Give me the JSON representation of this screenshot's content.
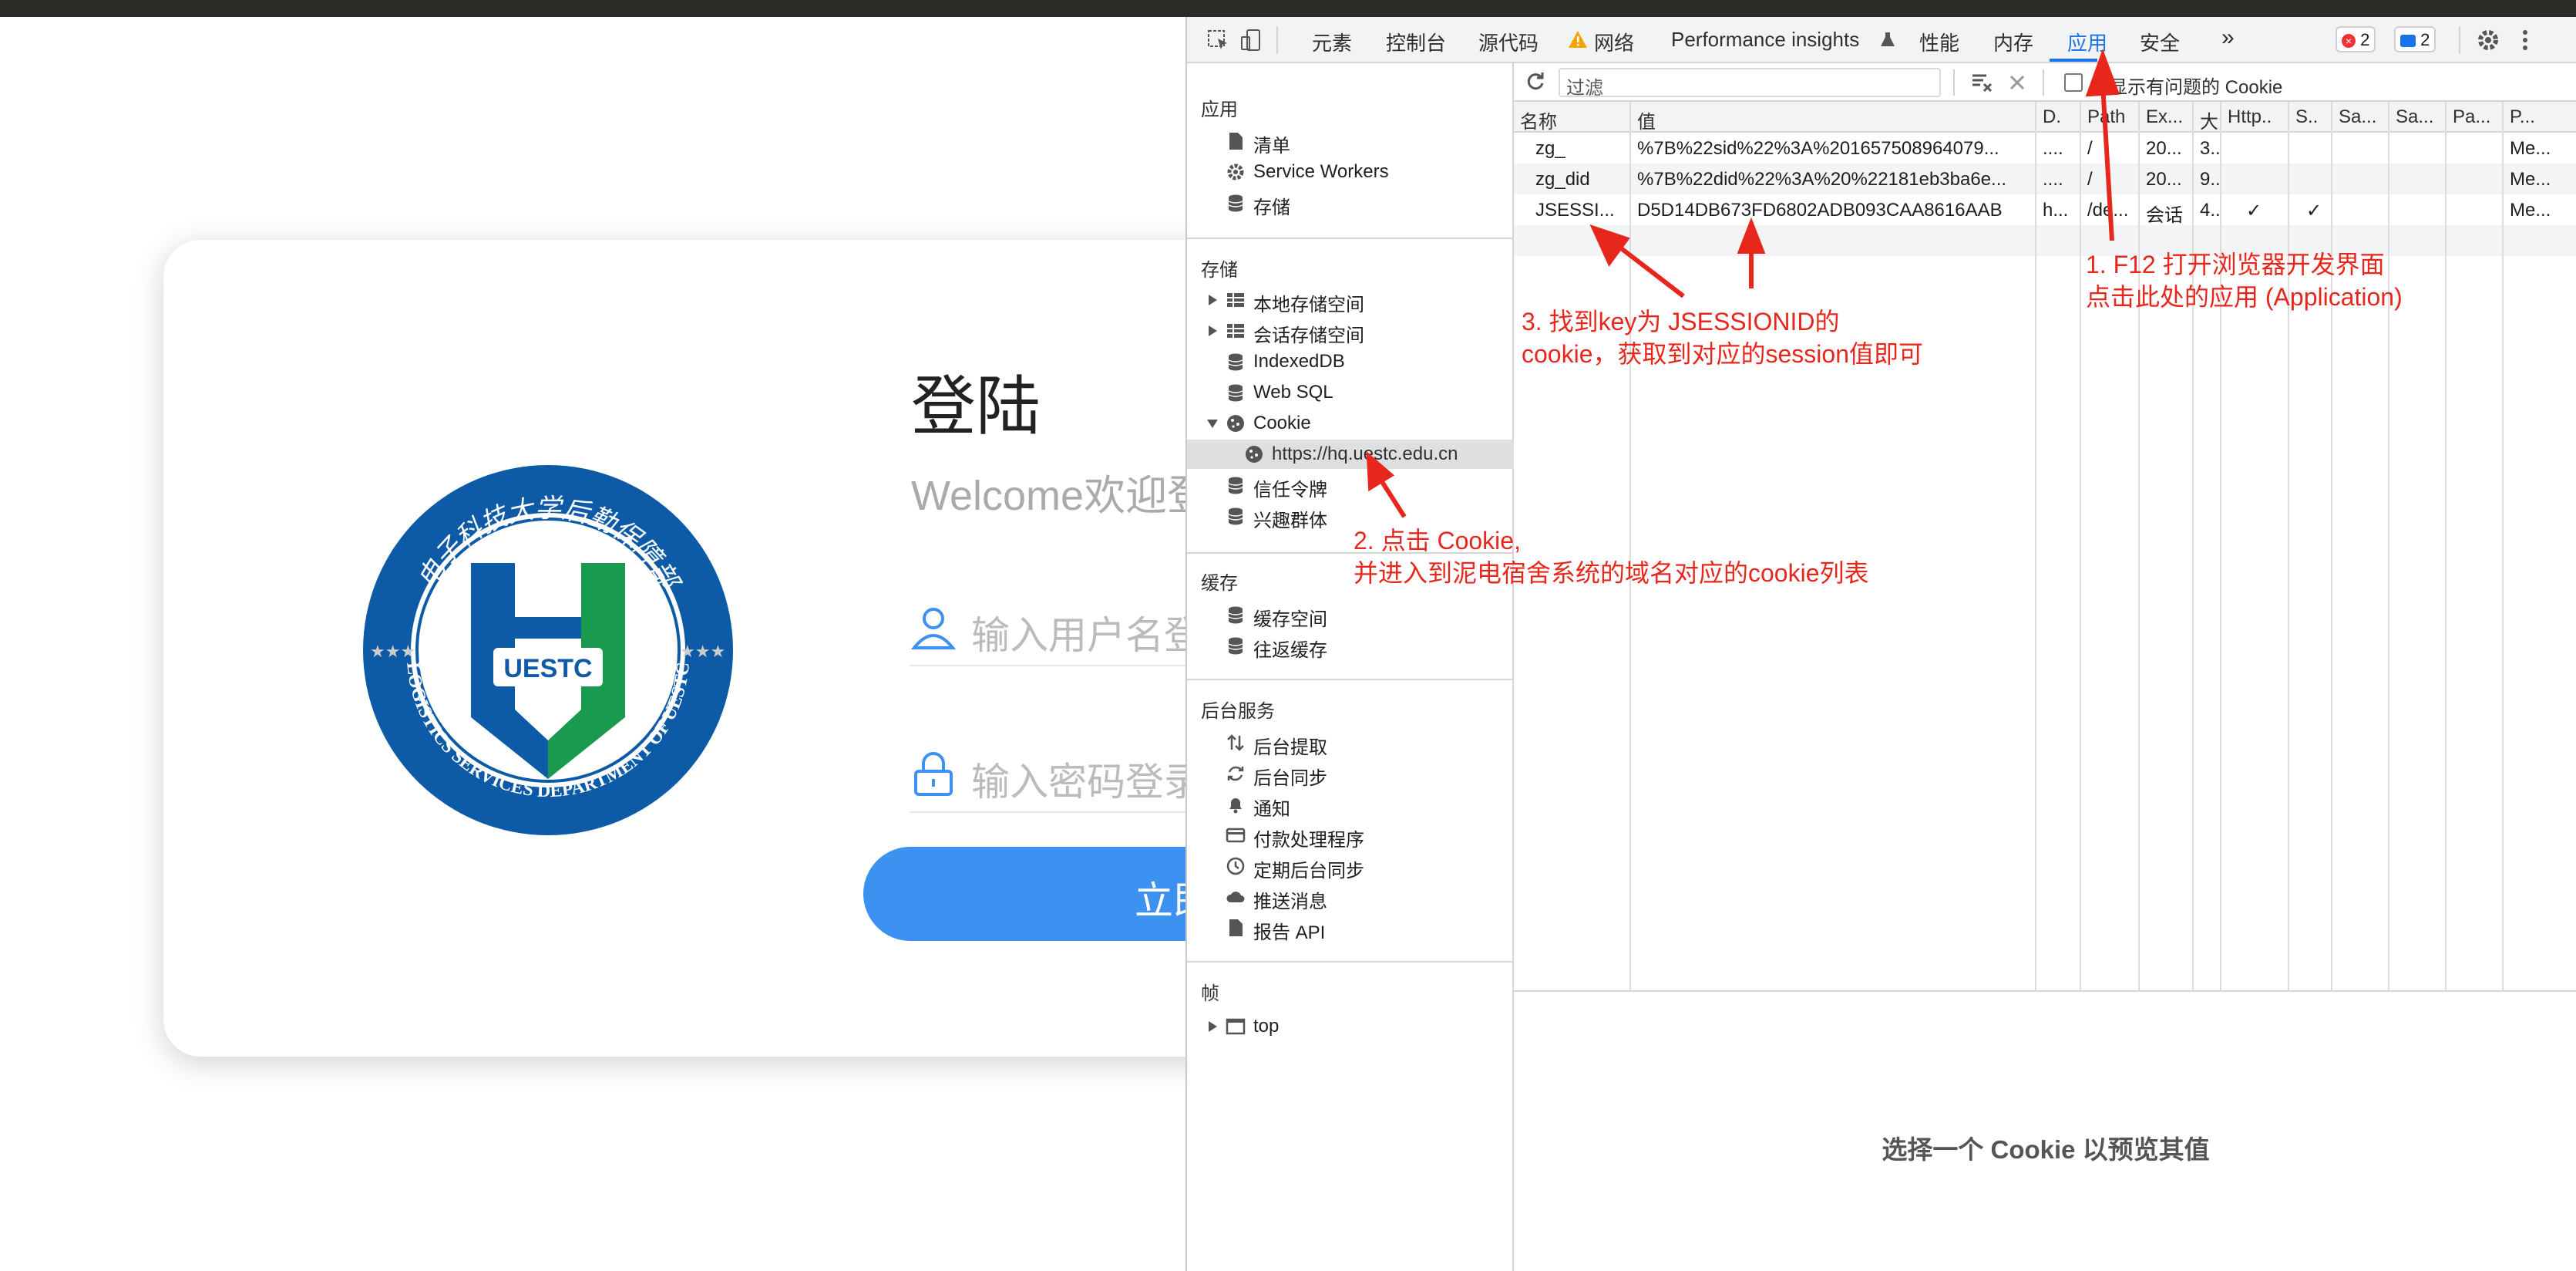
{
  "colors": {
    "accent": "#1a73e8",
    "annotation": "#e8271c",
    "login_button": "#3d91f1",
    "logo_blue": "#0d5aa7",
    "logo_green": "#1a9a4e"
  },
  "login": {
    "title": "登陆",
    "subtitle": "Welcome欢迎登",
    "username_placeholder": "输入用户名登",
    "password_placeholder": "输入密码登录",
    "button_label": "立即",
    "logo_monogram": "UESTC",
    "logo_ring_text": "LOGISTICS SERVICES DEPARTMENT OF UESTC",
    "logo_top_text": "电子科技大学后勤保障部",
    "icons": {
      "user": "user-icon",
      "lock": "lock-icon"
    }
  },
  "devtools": {
    "toolbar": {
      "tabs": [
        "元素",
        "控制台",
        "源代码",
        "网络",
        "Performance insights",
        "性能",
        "内存",
        "应用",
        "安全"
      ],
      "active_tab": "应用",
      "more": "»",
      "errors_count": "2",
      "messages_count": "2",
      "icons": [
        "inspect-icon",
        "device-toggle-icon",
        "warning-icon",
        "flask-icon",
        "settings-icon",
        "kebab-icon"
      ]
    },
    "sidebar": {
      "sections": [
        {
          "title": "应用",
          "items": [
            {
              "label": "清单",
              "icon": "file-icon"
            },
            {
              "label": "Service Workers",
              "icon": "gear-icon"
            },
            {
              "label": "存储",
              "icon": "database-icon"
            }
          ]
        },
        {
          "title": "存储",
          "items": [
            {
              "label": "本地存储空间",
              "icon": "grid-icon",
              "expand": "collapsed"
            },
            {
              "label": "会话存储空间",
              "icon": "grid-icon",
              "expand": "collapsed"
            },
            {
              "label": "IndexedDB",
              "icon": "database-icon"
            },
            {
              "label": "Web SQL",
              "icon": "database-icon"
            },
            {
              "label": "Cookie",
              "icon": "cookie-icon",
              "expand": "expanded"
            },
            {
              "label": "https://hq.uestc.edu.cn",
              "icon": "cookie-icon",
              "selected": true
            },
            {
              "label": "信任令牌",
              "icon": "database-icon"
            },
            {
              "label": "兴趣群体",
              "icon": "database-icon"
            }
          ]
        },
        {
          "title": "缓存",
          "items": [
            {
              "label": "缓存空间",
              "icon": "database-icon"
            },
            {
              "label": "往返缓存",
              "icon": "database-icon"
            }
          ]
        },
        {
          "title": "后台服务",
          "items": [
            {
              "label": "后台提取",
              "icon": "updown-arrows-icon"
            },
            {
              "label": "后台同步",
              "icon": "sync-icon"
            },
            {
              "label": "通知",
              "icon": "bell-icon"
            },
            {
              "label": "付款处理程序",
              "icon": "card-icon"
            },
            {
              "label": "定期后台同步",
              "icon": "clock-icon"
            },
            {
              "label": "推送消息",
              "icon": "cloud-icon"
            },
            {
              "label": "报告 API",
              "icon": "file-icon"
            }
          ]
        },
        {
          "title": "帧",
          "items": [
            {
              "label": "top",
              "icon": "frame-icon",
              "expand": "collapsed"
            }
          ]
        }
      ]
    },
    "filter": {
      "placeholder": "过滤",
      "show_issues_label": "仅显示有问题的 Cookie"
    },
    "cookie_table": {
      "headers": [
        "名称",
        "值",
        "D.",
        "Path",
        "Ex...",
        "大",
        "Http..",
        "S..",
        "Sa...",
        "Sa...",
        "Pa...",
        "P..."
      ],
      "rows": [
        [
          "zg_",
          "%7B%22sid%22%3A%201657508964079...",
          "....",
          "/",
          "20...",
          "3..",
          "",
          "",
          "",
          "",
          "",
          "Me..."
        ],
        [
          "zg_did",
          "%7B%22did%22%3A%20%22181eb3ba6e...",
          "....",
          "/",
          "20...",
          "9..",
          "",
          "",
          "",
          "",
          "",
          "Me..."
        ],
        [
          "JSESSI...",
          "D5D14DB673FD6802ADB093CAA8616AAB",
          "h...",
          "/de...",
          "会话",
          "4..",
          "✓",
          "✓",
          "",
          "",
          "",
          "Me..."
        ]
      ]
    },
    "preview_message": "选择一个 Cookie 以预览其值"
  },
  "annotations": {
    "step1": [
      "1. F12 打开浏览器开发界面",
      "点击此处的应用 (Application)"
    ],
    "step2": [
      "2. 点击 Cookie,",
      "并进入到泥电宿舍系统的域名对应的cookie列表"
    ],
    "step3": [
      "3. 找到key为 JSESSIONID的",
      "cookie，获取到对应的session值即可"
    ]
  }
}
